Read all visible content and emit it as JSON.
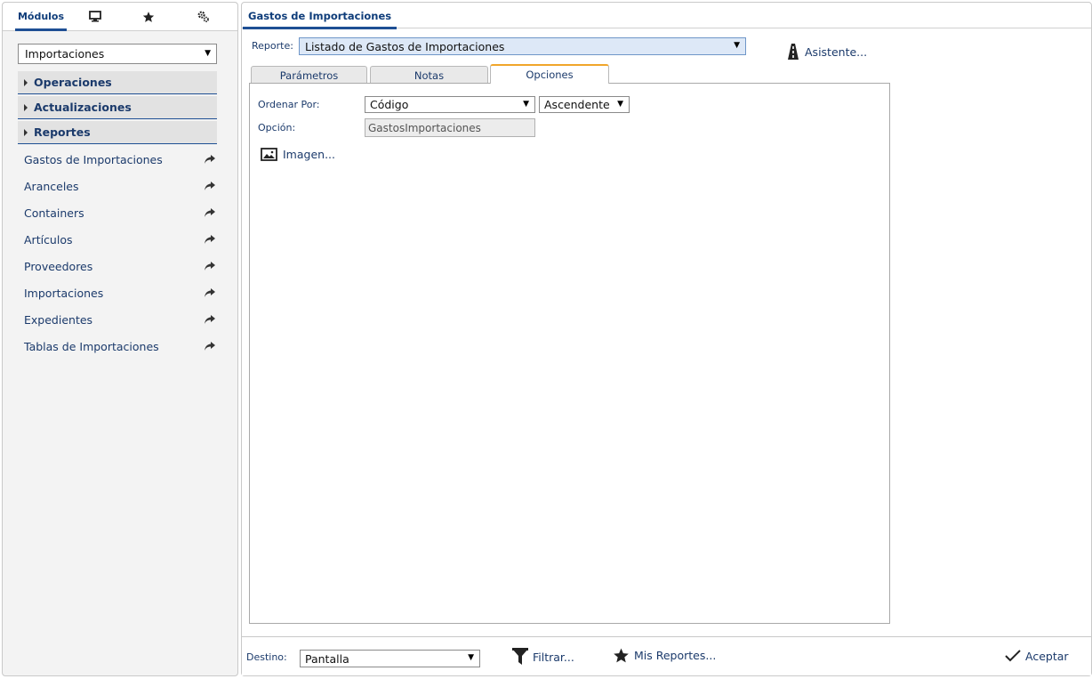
{
  "left": {
    "tabs": {
      "modules_label": "Módulos"
    },
    "module_select": {
      "value": "Importaciones"
    },
    "sections": [
      "Operaciones",
      "Actualizaciones",
      "Reportes"
    ],
    "items": [
      "Gastos de Importaciones",
      "Aranceles",
      "Containers",
      "Artículos",
      "Proveedores",
      "Importaciones",
      "Expedientes",
      "Tablas de Importaciones"
    ]
  },
  "right": {
    "title": "Gastos de Importaciones",
    "report_label": "Reporte:",
    "report_value": "Listado de Gastos de Importaciones",
    "wizard_label": "Asistente...",
    "tabs": [
      "Parámetros",
      "Notas",
      "Opciones"
    ],
    "active_tab": "Opciones",
    "options": {
      "order_label": "Ordenar Por:",
      "order_value": "Código",
      "direction_value": "Ascendente",
      "option_label": "Opción:",
      "option_value": "GastosImportaciones",
      "image_label": "Imagen..."
    },
    "footer": {
      "destination_label": "Destino:",
      "destination_value": "Pantalla",
      "filter_label": "Filtrar...",
      "my_reports_label": "Mis Reportes...",
      "accept_label": "Aceptar"
    }
  },
  "colors": {
    "accent": "#1e4f94",
    "active_tab_top": "#f0a62a",
    "text": "#1b3a6b"
  }
}
